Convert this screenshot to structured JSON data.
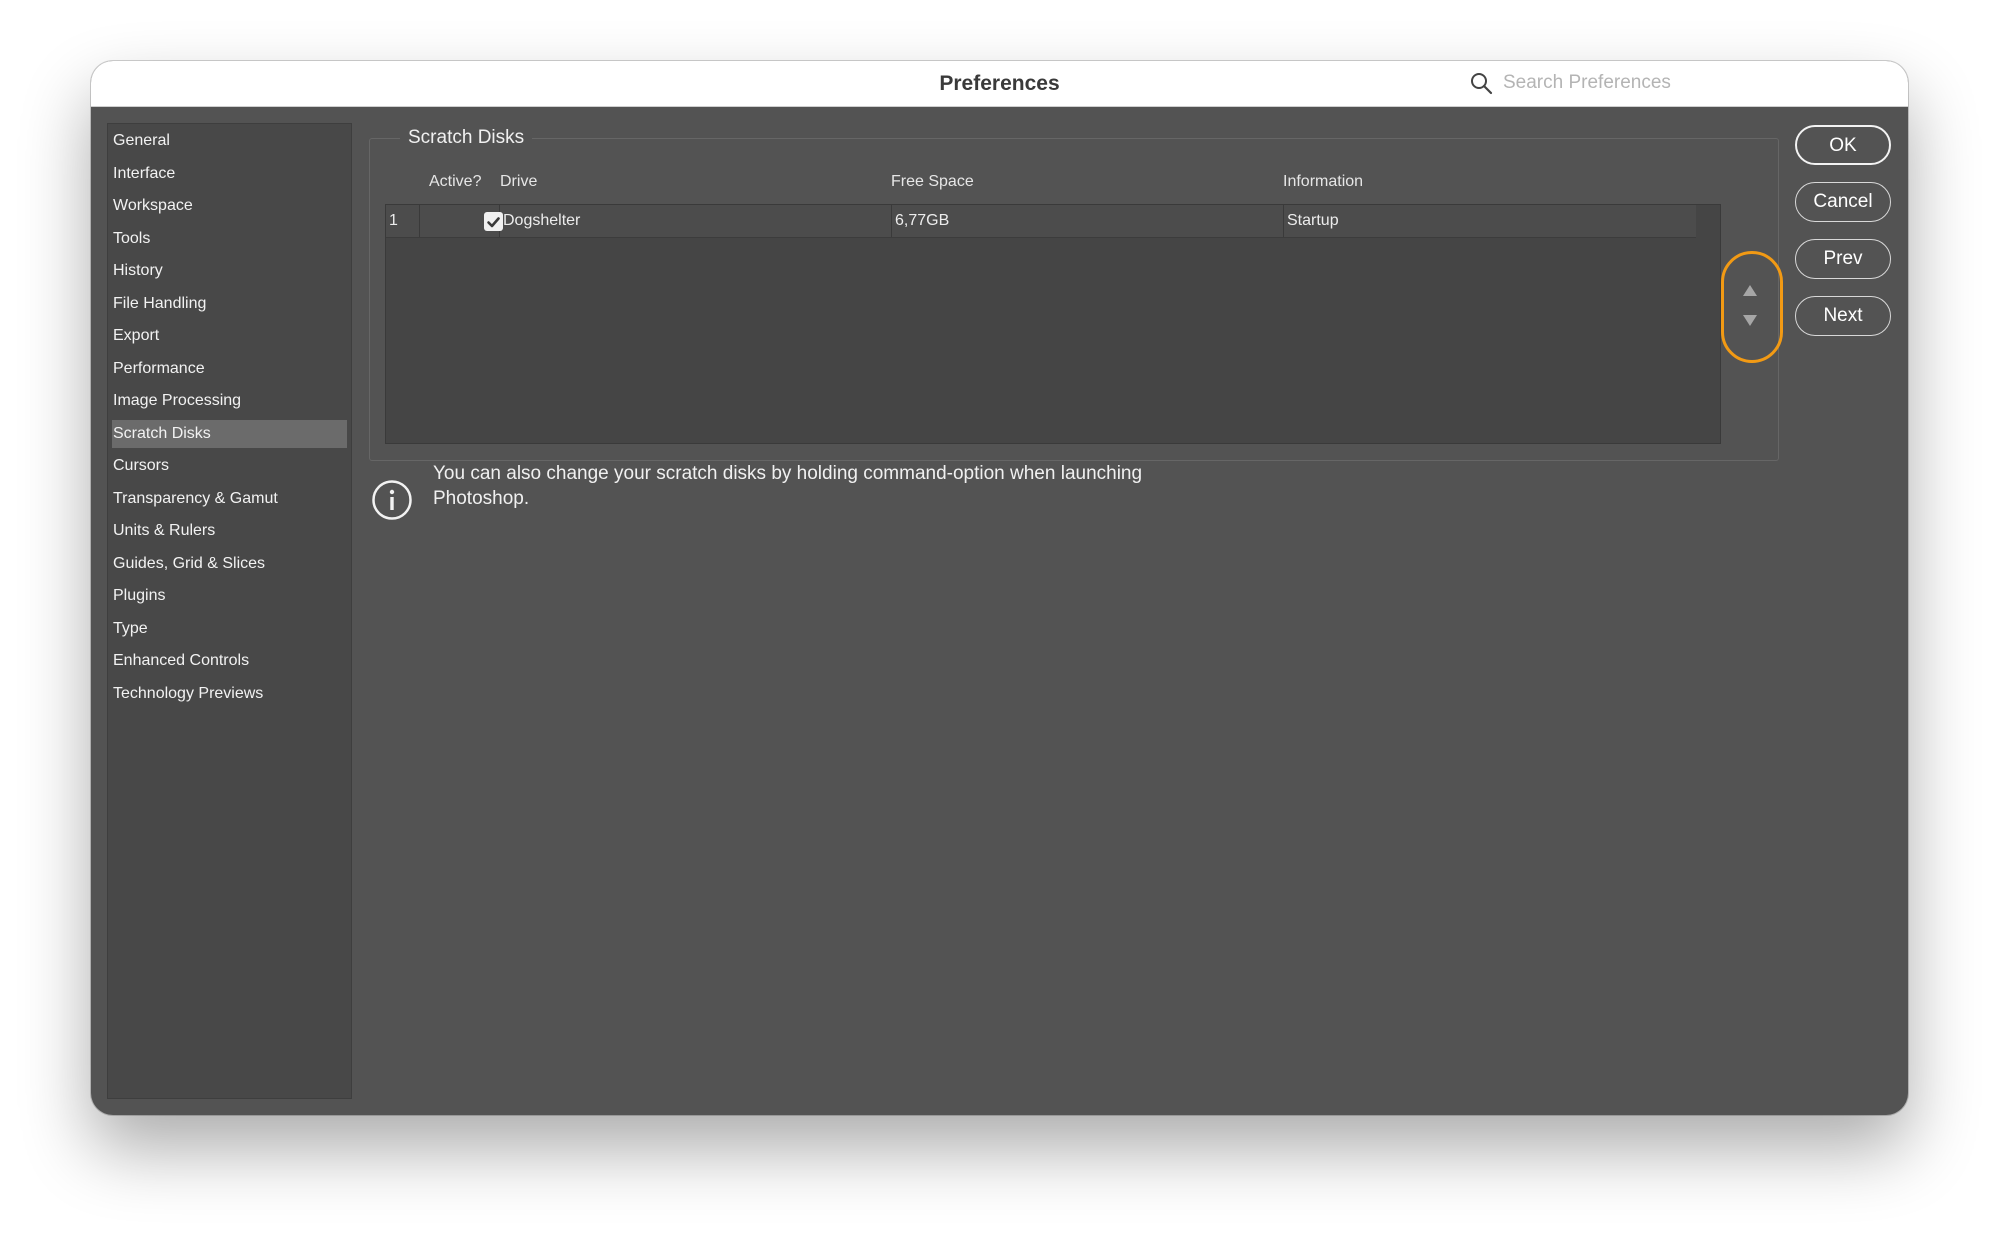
{
  "window": {
    "title": "Preferences"
  },
  "search": {
    "placeholder": "Search Preferences",
    "icon": "search-icon"
  },
  "sidebar": {
    "selected": "Scratch Disks",
    "items": [
      "General",
      "Interface",
      "Workspace",
      "Tools",
      "History",
      "File Handling",
      "Export",
      "Performance",
      "Image Processing",
      "Scratch Disks",
      "Cursors",
      "Transparency & Gamut",
      "Units & Rulers",
      "Guides, Grid & Slices",
      "Plugins",
      "Type",
      "Enhanced Controls",
      "Technology Previews"
    ]
  },
  "scratch_disks": {
    "title": "Scratch Disks",
    "columns": [
      "Active?",
      "Drive",
      "Free Space",
      "Information"
    ],
    "rows": [
      {
        "index": "1",
        "active": true,
        "drive": "Dogshelter",
        "free_space": "6,77GB",
        "information": "Startup"
      }
    ],
    "info_text": "You can also change your scratch disks by holding command-option when launching Photoshop."
  },
  "buttons": {
    "ok": "OK",
    "cancel": "Cancel",
    "prev": "Prev",
    "next": "Next"
  },
  "colors": {
    "highlight_ring": "#f29a14",
    "panel_bg": "#535353",
    "selected_bg": "#6b6b6b"
  }
}
